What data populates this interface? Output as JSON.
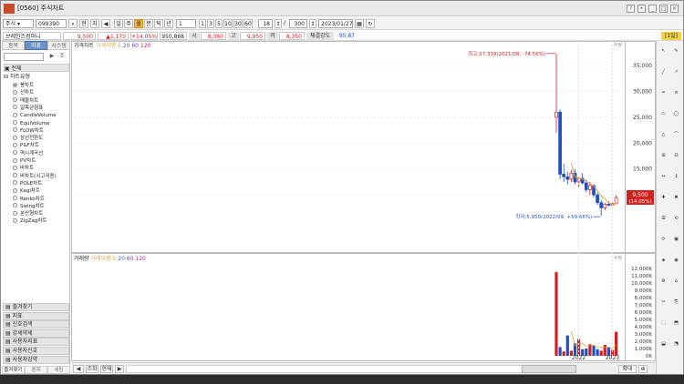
{
  "window": {
    "title": "[0560] 주식차트"
  },
  "toolbar": {
    "market": "주식",
    "code": "099390",
    "btn_h": "현",
    "btn_c": "차",
    "periods": [
      "일",
      "주",
      "월",
      "분",
      "틱",
      "년"
    ],
    "period_selected": "월",
    "interval_value": "1",
    "intervals": [
      "1",
      "3",
      "5",
      "10",
      "30",
      "60"
    ],
    "count_value": "18",
    "total_count": "300",
    "date": "2023/01/27"
  },
  "stock": {
    "name": "브레인즈컴퍼니"
  },
  "quote": {
    "price": "9,500",
    "change": "▲1,170",
    "change_pct": "+14.05%",
    "volume": "950,868",
    "open_label": "시",
    "open": "8,360",
    "high_label": "고",
    "high": "9,950",
    "low_label": "저",
    "low": "8,350",
    "strength_label": "체결강도",
    "strength": "95.87",
    "unit": "[1일]"
  },
  "sidebar": {
    "tabs": [
      "종목",
      "지표",
      "시스템"
    ],
    "active_tab": "지표",
    "search_btn": "조",
    "search_btn2": "▶",
    "group_all": "전체",
    "group_type": "차트유형",
    "chart_types": [
      "봉차트",
      "선차트",
      "매물차트",
      "일목균형표",
      "CandleVolume",
      "EquiVolume",
      "FLOW차트",
      "삼선전환도",
      "P&F차트",
      "역시계곡선",
      "PV차트",
      "바차트",
      "바차트(시고저종)",
      "POLE차트",
      "Kagi차트",
      "Renko차트",
      "Swing차트",
      "분산형차트",
      "ZigZag차트"
    ],
    "selected_type": "봉차트",
    "bottom_items": [
      "즐겨찾기",
      "지표",
      "신호검색",
      "강세약세",
      "사용자지표",
      "사용자신호",
      "사용자강약"
    ],
    "bottom_tabs": [
      "즐겨찾기",
      "종목",
      "세팅"
    ]
  },
  "price_panel": {
    "legend": [
      "가격차트",
      "가격이평",
      "5",
      "20",
      "60",
      "120"
    ],
    "y_ticks": [
      "35,000",
      "30,000",
      "25,000",
      "20,000",
      "15,000",
      "10,000"
    ],
    "max_annotation": "최고:37,339(2021/08, -74.56%)",
    "min_annotation": "최저:5,950(2022/09, +59.66%)",
    "last_price_tag": "9,500",
    "last_pct_tag": "(14.05%)",
    "corner_label": "수정"
  },
  "volume_panel": {
    "legend": [
      "거래량",
      "거래이평",
      "5",
      "20",
      "60",
      "120"
    ],
    "y_ticks": [
      "12,000K",
      "11,000K",
      "10,000K",
      "9,000K",
      "8,000K",
      "7,000K",
      "6,000K",
      "5,000K",
      "4,000K",
      "3,000K",
      "2,000K",
      "1,000K",
      "0K"
    ],
    "corner_label": "수정"
  },
  "x_axis": {
    "labels": [
      "2022",
      "2023"
    ]
  },
  "hscroll": {
    "left": "조회",
    "mid": "현재",
    "right": "확대"
  },
  "colors": {
    "up": "#d02020",
    "down": "#2050c0",
    "ma5": "#d4a44a",
    "ma20": "#2a6ad8",
    "ma60": "#8a2be2",
    "ma120": "#b0307a"
  },
  "chart_data": [
    {
      "type": "candlestick",
      "title": "가격차트",
      "ylim": [
        0,
        38000
      ],
      "x_labels": [
        "2022",
        "2023"
      ],
      "candles": [
        {
          "o": 25000,
          "h": 37339,
          "l": 22000,
          "c": 26000
        },
        {
          "o": 26000,
          "h": 26500,
          "l": 13000,
          "c": 14000
        },
        {
          "o": 14000,
          "h": 16000,
          "l": 12500,
          "c": 13500
        },
        {
          "o": 13500,
          "h": 14500,
          "l": 12000,
          "c": 13000
        },
        {
          "o": 13000,
          "h": 14800,
          "l": 12500,
          "c": 14200
        },
        {
          "o": 14200,
          "h": 15000,
          "l": 12000,
          "c": 12500
        },
        {
          "o": 12500,
          "h": 13500,
          "l": 11500,
          "c": 13200
        },
        {
          "o": 13200,
          "h": 14200,
          "l": 12000,
          "c": 12300
        },
        {
          "o": 12300,
          "h": 13000,
          "l": 10500,
          "c": 11000
        },
        {
          "o": 11000,
          "h": 12500,
          "l": 10000,
          "c": 11800
        },
        {
          "o": 11800,
          "h": 12000,
          "l": 9500,
          "c": 10000
        },
        {
          "o": 10000,
          "h": 10500,
          "l": 8000,
          "c": 8500
        },
        {
          "o": 8500,
          "h": 9000,
          "l": 5950,
          "c": 7500
        },
        {
          "o": 7500,
          "h": 8500,
          "l": 7000,
          "c": 8200
        },
        {
          "o": 8200,
          "h": 8800,
          "l": 7800,
          "c": 8000
        },
        {
          "o": 8000,
          "h": 8600,
          "l": 7700,
          "c": 8300
        },
        {
          "o": 8300,
          "h": 9950,
          "l": 8200,
          "c": 9500
        }
      ]
    },
    {
      "type": "bar",
      "title": "거래량",
      "unit": "K",
      "ylim": [
        0,
        12500
      ],
      "values": [
        11500,
        1200,
        600,
        2800,
        700,
        1700,
        2300,
        900,
        1000,
        1600,
        1400,
        900,
        700,
        1500,
        1200,
        800,
        3300
      ],
      "up": [
        true,
        false,
        true,
        false,
        true,
        false,
        true,
        false,
        false,
        true,
        false,
        false,
        true,
        true,
        false,
        true,
        true
      ]
    }
  ]
}
